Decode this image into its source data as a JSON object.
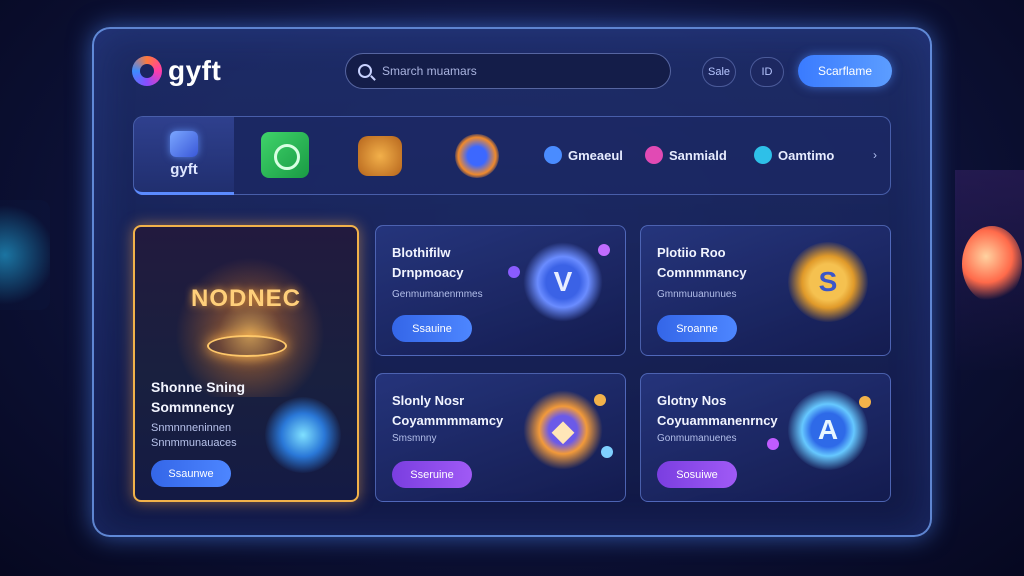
{
  "header": {
    "logo_text": "gyft",
    "search_placeholder": "Smarch muamars",
    "chip_a": "Sale",
    "chip_b": "ID",
    "cta_label": "Scarflame"
  },
  "brands": {
    "active_label": "gyft",
    "items": [
      {
        "name": "Gmeaeul",
        "icon": "blue-dot"
      },
      {
        "name": "Sanmiald",
        "icon": "pink-dot"
      },
      {
        "name": "Oamtimo",
        "icon": "cyan-dot"
      }
    ],
    "more": "›"
  },
  "feature": {
    "hero_title": "NODNEC",
    "title_line1": "Shonne Sning",
    "title_line2": "Sommnency",
    "sub_line1": "Snmnnneninnen",
    "sub_line2": "Snnmmunauaces",
    "button": "Ssaunwe"
  },
  "cards": [
    {
      "title_line1": "Blothifilw",
      "title_line2": "Drnpmoacy",
      "sub": "Genmumanenmmes",
      "button": "Ssauine",
      "emblem": "V"
    },
    {
      "title_line1": "Plotiio Roo",
      "title_line2": "Comnmmancy",
      "sub": "Gmnmuuanunues",
      "button": "Sroanne",
      "emblem": "S"
    },
    {
      "title_line1": "Slonly Nosr",
      "title_line2": "Coyammmmamcy",
      "sub": "Smsmnny",
      "button": "Sseruine",
      "emblem": "◆"
    },
    {
      "title_line1": "Glotny Nos",
      "title_line2": "Coyuammanenrncy",
      "sub": "Gonmumanuenes",
      "button": "Sosuiwe",
      "emblem": "A"
    }
  ],
  "colors": {
    "accent": "#4d86ff",
    "feature_border": "#f2b24a",
    "purple_button": "#8a4cf0"
  }
}
